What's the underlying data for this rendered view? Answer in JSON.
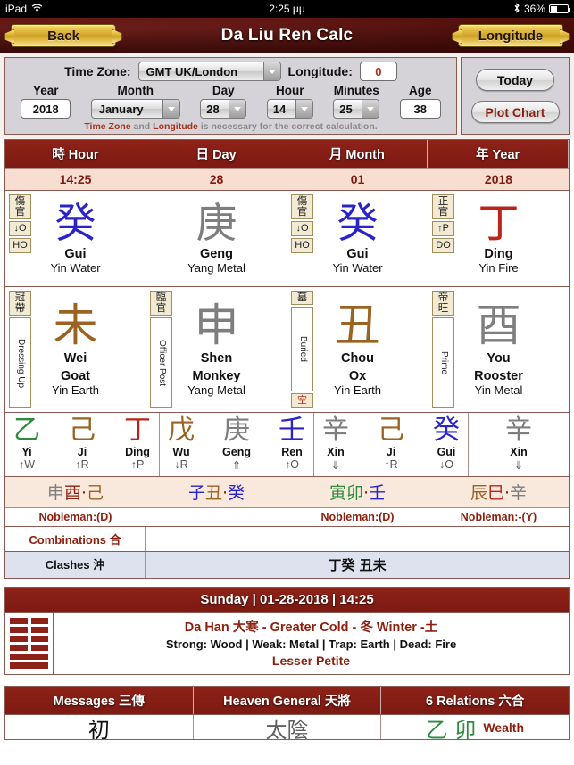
{
  "status_bar": {
    "device": "iPad",
    "wifi_icon": "wifi-icon",
    "time": "2:25 μμ",
    "bluetooth_icon": "bluetooth-icon",
    "battery_pct": "36%"
  },
  "titlebar": {
    "back_label": "Back",
    "title": "Da Liu Ren Calc",
    "longitude_label": "Longitude"
  },
  "form": {
    "timezone_label": "Time Zone:",
    "timezone_value": "GMT UK/London",
    "longitude_label": "Longitude:",
    "longitude_value": "0",
    "year_label": "Year",
    "year_value": "2018",
    "month_label": "Month",
    "month_value": "January",
    "day_label": "Day",
    "day_value": "28",
    "hour_label": "Hour",
    "hour_value": "14",
    "minutes_label": "Minutes",
    "minutes_value": "25",
    "age_label": "Age",
    "age_value": "38",
    "note_a": "Time Zone",
    "note_b": " and ",
    "note_c": "Longitude",
    "note_d": " is necessary for the correct calculation.",
    "today_label": "Today",
    "plot_label": "Plot Chart"
  },
  "chart_table": {
    "headers": [
      "時 Hour",
      "日 Day",
      "月 Month",
      "年 Year"
    ],
    "values": [
      "14:25",
      "28",
      "01",
      "2018"
    ],
    "stems": [
      {
        "badge_cn": "傷官",
        "badge_mid": "↓O",
        "badge_sm": "HO",
        "glyph": "癸",
        "color": "c-blue",
        "name": "Gui",
        "element": "Yin Water"
      },
      {
        "badge_cn": "",
        "badge_mid": "",
        "badge_sm": "",
        "glyph": "庚",
        "color": "c-gray",
        "name": "Geng",
        "element": "Yang Metal"
      },
      {
        "badge_cn": "傷官",
        "badge_mid": "↓O",
        "badge_sm": "HO",
        "glyph": "癸",
        "color": "c-blue",
        "name": "Gui",
        "element": "Yin Water"
      },
      {
        "badge_cn": "正官",
        "badge_mid": "↑P",
        "badge_sm": "DO",
        "glyph": "丁",
        "color": "c-red",
        "name": "Ding",
        "element": "Yin Fire"
      }
    ],
    "branches": [
      {
        "badge_cn": "冠帶",
        "badge_vert": "Dressing Up",
        "badge_sm": "",
        "glyph": "未",
        "color": "c-brown",
        "name": "Wei",
        "animal": "Goat",
        "element": "Yin Earth"
      },
      {
        "badge_cn": "臨官",
        "badge_vert": "Officer Post",
        "badge_sm": "",
        "glyph": "申",
        "color": "c-gray",
        "name": "Shen",
        "animal": "Monkey",
        "element": "Yang Metal"
      },
      {
        "badge_cn": "墓",
        "badge_vert": "Buried",
        "badge_sm": "空",
        "glyph": "丑",
        "color": "c-brown",
        "name": "Chou",
        "animal": "Ox",
        "element": "Yin Earth"
      },
      {
        "badge_cn": "帝旺",
        "badge_vert": "Prime",
        "badge_sm": "",
        "glyph": "酉",
        "color": "c-gray",
        "name": "You",
        "animal": "Rooster",
        "element": "Yin Metal"
      }
    ],
    "hidden": [
      [
        {
          "glyph": "乙",
          "color": "c-green",
          "name": "Yi",
          "mark": "↑W"
        },
        {
          "glyph": "己",
          "color": "c-brown",
          "name": "Ji",
          "mark": "↑R"
        },
        {
          "glyph": "丁",
          "color": "c-red",
          "name": "Ding",
          "mark": "↑P"
        }
      ],
      [
        {
          "glyph": "戊",
          "color": "c-brown",
          "name": "Wu",
          "mark": "↓R"
        },
        {
          "glyph": "庚",
          "color": "c-gray",
          "name": "Geng",
          "mark": "⇑"
        },
        {
          "glyph": "壬",
          "color": "c-blue",
          "name": "Ren",
          "mark": "↑O"
        }
      ],
      [
        {
          "glyph": "辛",
          "color": "c-gray",
          "name": "Xin",
          "mark": "⇓"
        },
        {
          "glyph": "己",
          "color": "c-brown",
          "name": "Ji",
          "mark": "↑R"
        },
        {
          "glyph": "癸",
          "color": "c-blue",
          "name": "Gui",
          "mark": "↓O"
        }
      ],
      [
        {
          "glyph": "辛",
          "color": "c-gray",
          "name": "Xin",
          "mark": "⇓"
        }
      ]
    ],
    "nobleman_glyphs": [
      [
        {
          "t": "申",
          "c": "c-gray"
        },
        {
          "t": "酉",
          "c": "c-dred"
        },
        {
          "t": "·",
          "c": "c-dred"
        },
        {
          "t": "己",
          "c": "c-brown"
        }
      ],
      [
        {
          "t": "子",
          "c": "c-blue"
        },
        {
          "t": "丑",
          "c": "c-brown"
        },
        {
          "t": "·",
          "c": "c-dred"
        },
        {
          "t": "癸",
          "c": "c-blue"
        }
      ],
      [
        {
          "t": "寅",
          "c": "c-green"
        },
        {
          "t": "卯",
          "c": "c-green"
        },
        {
          "t": "·",
          "c": "c-dred"
        },
        {
          "t": "壬",
          "c": "c-blue"
        }
      ],
      [
        {
          "t": "辰",
          "c": "c-brown"
        },
        {
          "t": "巳",
          "c": "c-red"
        },
        {
          "t": "·",
          "c": "c-dred"
        },
        {
          "t": "辛",
          "c": "c-gray"
        }
      ]
    ],
    "nobleman_labels": [
      "Nobleman:(D)",
      "",
      "Nobleman:(D)",
      "Nobleman:-(Y)"
    ],
    "combinations_label": "Combinations 合",
    "combinations_value": "",
    "clashes_label": "Clashes 沖",
    "clashes_value": "丁癸  丑未"
  },
  "banner": {
    "date_line": "Sunday | 01-28-2018 | 14:25",
    "hexagram_icon": "hexagram-icon",
    "lines": [
      "broken",
      "broken",
      "broken",
      "broken",
      "solid",
      "solid"
    ],
    "season": "Da Han 大寒 - Greater Cold - 冬 Winter  -土",
    "elements": "Strong: Wood | Weak: Metal | Trap: Earth | Dead: Fire",
    "petite": "Lesser Petite"
  },
  "bottom": {
    "headers": [
      "Messages 三傳",
      "Heaven General 天將",
      "6 Relations 六合"
    ],
    "row": {
      "messages": "初",
      "heaven_general": "太陰",
      "relation_glyph_a": "乙",
      "relation_glyph_b": "卯",
      "relation_label": "Wealth"
    }
  }
}
